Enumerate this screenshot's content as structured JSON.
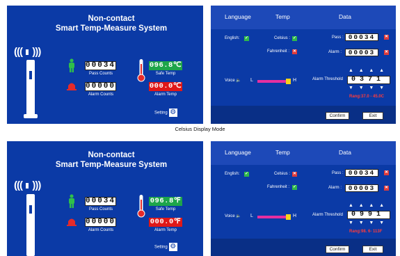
{
  "title_line1": "Non-contact",
  "title_line2": "Smart Temp-Measure System",
  "caption": "Celsius Display Mode",
  "main": {
    "pass_count": "00034",
    "pass_label": "Pass Counts",
    "alarm_count": "00000",
    "alarm_label": "Alarm Counts",
    "safe_label": "Safe Temp",
    "alarm_temp_label": "Alarm Temp",
    "setting_label": "Setting",
    "celsius": {
      "safe_temp": "096.8℃",
      "alarm_temp": "000.0℃"
    },
    "fahrenheit": {
      "safe_temp": "096.8℉",
      "alarm_temp": "000.0℉"
    }
  },
  "settings": {
    "tabs": [
      "Language",
      "Temp",
      "Data"
    ],
    "english": "English:",
    "celsius": "Celsius :",
    "fahrenheit": "Fahrenheit :",
    "pass": "Pass :",
    "alarm": "Alarm :",
    "voice": "Voice",
    "low": "L",
    "high": "H",
    "threshold_label": "Alarm Threshold",
    "confirm": "Confirm",
    "exit": "Exit",
    "pass_value": "00034",
    "alarm_value": "00003",
    "celsius_mode": {
      "threshold": "0371",
      "range": "Rang:37.0 - 45.0C",
      "celsius_checked": "✓",
      "fahrenheit_checked": "✕"
    },
    "fahrenheit_mode": {
      "threshold": "0991",
      "range": "Rang:98. 6- 113F",
      "celsius_checked": "✕",
      "fahrenheit_checked": "✓"
    },
    "english_checked": "✓"
  },
  "colors": {
    "panel": "#0b3aa6",
    "green": "#1ea54a",
    "red": "#e01818",
    "slider": "#e52fa0"
  }
}
